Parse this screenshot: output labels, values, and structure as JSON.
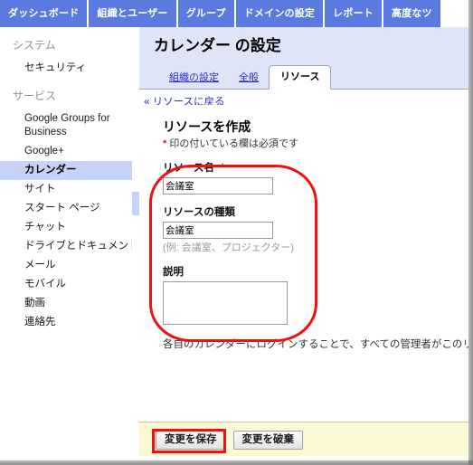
{
  "topnav": {
    "tabs": [
      {
        "label": "ダッシュボード",
        "active": false
      },
      {
        "label": "組織とユーザー",
        "active": false
      },
      {
        "label": "グループ",
        "active": false
      },
      {
        "label": "ドメインの設定",
        "active": false
      },
      {
        "label": "レポート",
        "active": false
      },
      {
        "label": "高度なツ",
        "active": false
      }
    ]
  },
  "sidebar": {
    "groups": [
      {
        "title": "システム",
        "items": [
          {
            "label": "セキュリティ",
            "selected": false
          }
        ]
      },
      {
        "title": "サービス",
        "items": [
          {
            "label": "Google Groups for Business",
            "selected": false
          },
          {
            "label": "Google+",
            "selected": false
          },
          {
            "label": "カレンダー",
            "selected": true
          },
          {
            "label": "サイト",
            "selected": false
          },
          {
            "label": "スタート ページ",
            "selected": false
          },
          {
            "label": "チャット",
            "selected": false
          },
          {
            "label": "ドライブとドキュメント",
            "selected": false
          },
          {
            "label": "メール",
            "selected": false
          },
          {
            "label": "モバイル",
            "selected": false
          },
          {
            "label": "動画",
            "selected": false
          },
          {
            "label": "連絡先",
            "selected": false
          }
        ]
      }
    ]
  },
  "content": {
    "page_title": "カレンダー の設定",
    "tabs": [
      {
        "label": "組織の設定",
        "active": false
      },
      {
        "label": "全般",
        "active": false
      },
      {
        "label": "リソース",
        "active": true
      }
    ],
    "back_link": "« リソースに戻る",
    "form": {
      "heading": "リソースを作成",
      "required_star": "*",
      "required_note": "印の付いている欄は必須です",
      "fields": {
        "resource_name": {
          "label": "リソース名",
          "required_star": "*",
          "value": "会議室",
          "placeholder": ""
        },
        "resource_type": {
          "label": "リソースの種類",
          "value": "会議室",
          "placeholder": "",
          "hint": "(例: 会議室、プロジェクター)"
        },
        "description": {
          "label": "説明",
          "value": "",
          "placeholder": ""
        }
      },
      "info_text": "各自のカレンダーにログインすることで、すべての管理者がこのリ"
    }
  },
  "footer": {
    "save_label": "変更を保存",
    "discard_label": "変更を破棄"
  },
  "colors": {
    "nav_blue": "#5b7ae0",
    "header_lavender": "#dfe4f7",
    "selected_item": "#c6d2f7",
    "footer_yellow": "#fbf8d4",
    "annotation_red": "#ee1111",
    "link_blue": "#2a2ad0"
  }
}
